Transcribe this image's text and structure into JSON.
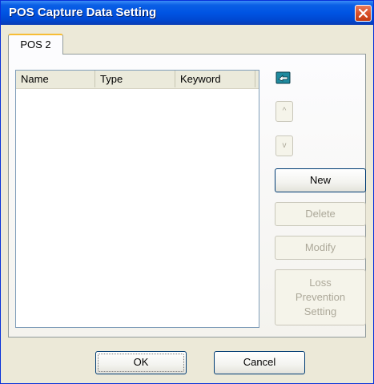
{
  "window": {
    "title": "POS Capture Data Setting"
  },
  "tabs": [
    {
      "label": "POS 2"
    }
  ],
  "list": {
    "columns": [
      {
        "label": "Name"
      },
      {
        "label": "Type"
      },
      {
        "label": "Keyword"
      }
    ],
    "rows": []
  },
  "side_buttons": {
    "up": "^",
    "down": "v",
    "new": "New",
    "delete": "Delete",
    "modify": "Modify",
    "loss_prevention": [
      "Loss",
      "Prevention",
      "Setting"
    ]
  },
  "footer": {
    "ok": "OK",
    "cancel": "Cancel"
  },
  "icons": {
    "close": "close-icon",
    "pointer": "pointing-hand-icon"
  }
}
